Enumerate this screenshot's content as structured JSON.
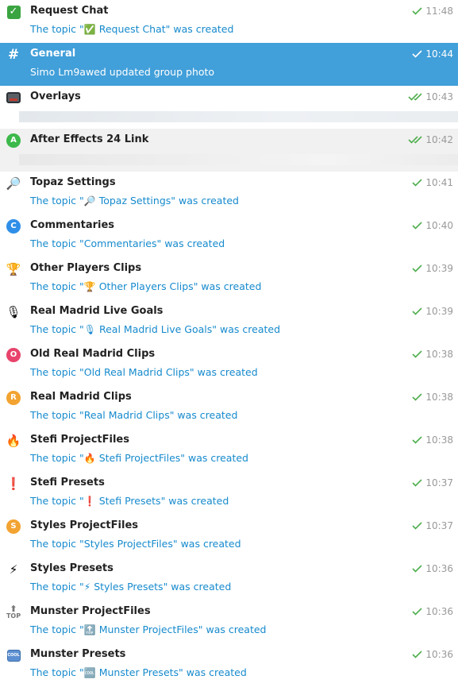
{
  "rows": [
    {
      "id": "request-chat",
      "icon": "green-check-icon",
      "icon_glyph": "✓",
      "title": "Request Chat",
      "subtitle_prefix": "The topic \"",
      "subtitle_emoji": "✅",
      "subtitle_name": " Request Chat",
      "subtitle_suffix": "\" was created",
      "time": "11:48",
      "ticks": "single",
      "state": "normal"
    },
    {
      "id": "general",
      "icon": "hashtag-icon",
      "icon_glyph": "#",
      "title": "General",
      "subtitle_text": "Simo Lm9awed updated group photo",
      "time": "10:44",
      "ticks": "single",
      "state": "selected"
    },
    {
      "id": "overlays",
      "icon": "tv-icon",
      "title": "Overlays",
      "time": "10:43",
      "ticks": "double",
      "state": "normal",
      "preview": "media"
    },
    {
      "id": "after-effects",
      "icon": "badge-a-icon",
      "icon_glyph": "A",
      "icon_color": "#3cb94a",
      "title": "After Effects 24 Link",
      "time": "10:42",
      "ticks": "double",
      "state": "hovered",
      "preview": "media"
    },
    {
      "id": "topaz",
      "icon": "magnifier-icon",
      "icon_glyph": "🔎",
      "title": "Topaz Settings",
      "subtitle_prefix": "The topic \"",
      "subtitle_emoji": "🔎",
      "subtitle_name": " Topaz Settings",
      "subtitle_suffix": "\" was created",
      "time": "10:41",
      "ticks": "single",
      "state": "normal"
    },
    {
      "id": "commentaries",
      "icon": "badge-c-icon",
      "icon_glyph": "C",
      "icon_color": "#2f8fe8",
      "title": "Commentaries",
      "subtitle_text": "The topic \"Commentaries\" was created",
      "time": "10:40",
      "ticks": "single",
      "state": "normal"
    },
    {
      "id": "other-players",
      "icon": "trophy-icon",
      "icon_glyph": "🏆",
      "title": "Other Players Clips",
      "subtitle_prefix": "The topic \"",
      "subtitle_emoji": "🏆",
      "subtitle_name": " Other Players Clips",
      "subtitle_suffix": "\" was created",
      "time": "10:39",
      "ticks": "single",
      "state": "normal"
    },
    {
      "id": "real-madrid-live",
      "icon": "microphone-icon",
      "icon_glyph": "🎙",
      "title": "Real Madrid Live Goals",
      "subtitle_prefix": "The topic \"",
      "subtitle_emoji": "🎙",
      "subtitle_name": " Real Madrid Live Goals",
      "subtitle_suffix": "\" was created",
      "time": "10:39",
      "ticks": "single",
      "state": "normal"
    },
    {
      "id": "old-real-madrid",
      "icon": "badge-o-icon",
      "icon_glyph": "O",
      "icon_color": "#e8436c",
      "title": "Old Real Madrid Clips",
      "subtitle_text": "The topic \"Old Real Madrid Clips\" was created",
      "time": "10:38",
      "ticks": "single",
      "state": "normal"
    },
    {
      "id": "real-madrid-clips",
      "icon": "badge-r-icon",
      "icon_glyph": "R",
      "icon_color": "#f2a331",
      "title": "Real Madrid Clips",
      "subtitle_text": "The topic \"Real Madrid Clips\" was created",
      "time": "10:38",
      "ticks": "single",
      "state": "normal"
    },
    {
      "id": "stefi-projectfiles",
      "icon": "fire-icon",
      "icon_glyph": "🔥",
      "title": "Stefi ProjectFiles",
      "subtitle_prefix": "The topic \"",
      "subtitle_emoji": "🔥",
      "subtitle_name": " Stefi ProjectFiles",
      "subtitle_suffix": "\" was created",
      "time": "10:38",
      "ticks": "single",
      "state": "normal"
    },
    {
      "id": "stefi-presets",
      "icon": "exclamation-icon",
      "icon_glyph": "❗",
      "title": "Stefi Presets",
      "subtitle_prefix": "The topic \"",
      "subtitle_emoji": "❗",
      "subtitle_name": " Stefi Presets",
      "subtitle_suffix": "\" was created",
      "time": "10:37",
      "ticks": "single",
      "state": "normal"
    },
    {
      "id": "styles-projectfiles",
      "icon": "badge-s-icon",
      "icon_glyph": "S",
      "icon_color": "#f2a331",
      "title": "Styles ProjectFiles",
      "subtitle_text": "The topic \"Styles ProjectFiles\" was created",
      "time": "10:37",
      "ticks": "single",
      "state": "normal"
    },
    {
      "id": "styles-presets",
      "icon": "lightning-icon",
      "icon_glyph": "⚡",
      "title": "Styles Presets",
      "subtitle_prefix": "The topic \"",
      "subtitle_emoji": "⚡",
      "subtitle_name": " Styles Presets",
      "subtitle_suffix": "\" was created",
      "time": "10:36",
      "ticks": "single",
      "state": "normal"
    },
    {
      "id": "munster-projectfiles",
      "icon": "top-arrow-icon",
      "icon_glyph": "TOP",
      "title": "Munster ProjectFiles",
      "subtitle_prefix": "The topic \"",
      "subtitle_emoji": "🔝",
      "subtitle_name": " Munster ProjectFiles",
      "subtitle_suffix": "\" was created",
      "time": "10:36",
      "ticks": "single",
      "state": "normal"
    },
    {
      "id": "munster-presets",
      "icon": "cool-icon",
      "icon_glyph": "COOL",
      "title": "Munster Presets",
      "subtitle_prefix": "The topic \"",
      "subtitle_emoji": "🆒",
      "subtitle_name": " Munster Presets",
      "subtitle_suffix": "\" was created",
      "time": "10:36",
      "ticks": "single",
      "state": "normal"
    }
  ],
  "colors": {
    "accent": "#419fd9",
    "link": "#168acd",
    "tick": "#4fae4e",
    "time": "#999999"
  }
}
